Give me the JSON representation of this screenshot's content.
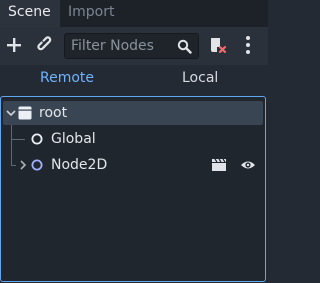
{
  "tabs": [
    {
      "label": "Scene",
      "active": true
    },
    {
      "label": "Import",
      "active": false
    }
  ],
  "toolbar": {
    "add_icon": "plus-icon",
    "link_icon": "link-icon",
    "filter_placeholder": "Filter Nodes",
    "search_icon": "search-icon",
    "script_icon": "script-icon",
    "menu_icon": "kebab-menu-icon"
  },
  "mode": {
    "remote_label": "Remote",
    "local_label": "Local",
    "remote_color": "#6fb3ff"
  },
  "tree": {
    "nodes": [
      {
        "label": "root",
        "icon": "window-icon",
        "selected": true,
        "expanded": true
      },
      {
        "label": "Global",
        "icon": "node-icon"
      },
      {
        "label": "Node2D",
        "icon": "node2d-icon",
        "collapsed": true,
        "badges": [
          "clapperboard-icon",
          "visibility-eye-icon"
        ]
      }
    ],
    "accent": "#5fa7f0"
  }
}
